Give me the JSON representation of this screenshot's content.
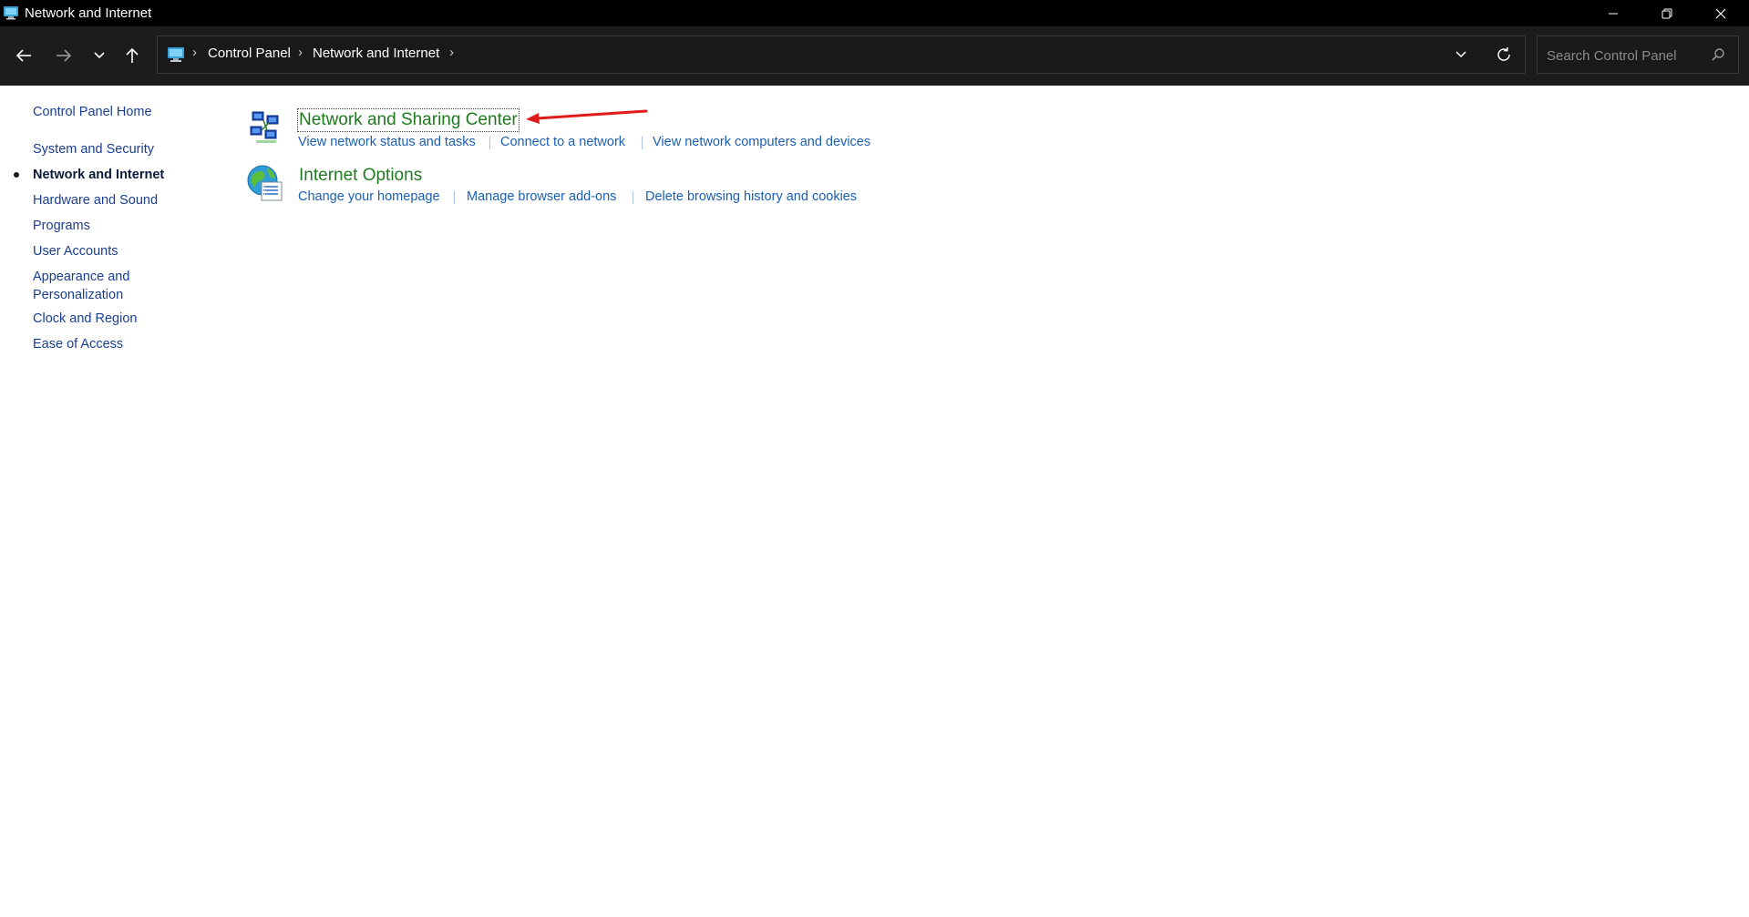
{
  "window": {
    "title": "Network and Internet"
  },
  "toolbar": {
    "breadcrumbs": [
      "Control Panel",
      "Network and Internet"
    ],
    "search_placeholder": "Search Control Panel"
  },
  "sidebar": {
    "items": [
      {
        "label": "Control Panel Home",
        "active": false
      },
      {
        "label": "System and Security",
        "active": false
      },
      {
        "label": "Network and Internet",
        "active": true
      },
      {
        "label": "Hardware and Sound",
        "active": false
      },
      {
        "label": "Programs",
        "active": false
      },
      {
        "label": "User Accounts",
        "active": false
      },
      {
        "label": "Appearance and",
        "active": false
      },
      {
        "label": "Personalization",
        "active": false
      },
      {
        "label": "Clock and Region",
        "active": false
      },
      {
        "label": "Ease of Access",
        "active": false
      }
    ]
  },
  "main": {
    "categories": [
      {
        "title": "Network and Sharing Center",
        "icon": "network-sharing-icon",
        "tasks": [
          "View network status and tasks",
          "Connect to a network",
          "View network computers and devices"
        ]
      },
      {
        "title": "Internet Options",
        "icon": "internet-options-icon",
        "tasks": [
          "Change your homepage",
          "Manage browser add-ons",
          "Delete browsing history and cookies"
        ]
      }
    ]
  },
  "colors": {
    "category_title": "#1f7a1f",
    "task_link": "#1a5fb4",
    "nav_link": "#1a3e8f",
    "annotation_arrow": "#e01b1b"
  }
}
